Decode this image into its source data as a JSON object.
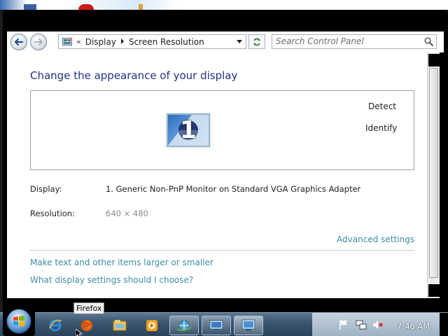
{
  "window": {
    "breadcrumb_separator_start": "«",
    "breadcrumb": [
      "Display",
      "Screen Resolution"
    ],
    "search_placeholder": "Search Control Panel"
  },
  "main": {
    "title": "Change the appearance of your display",
    "monitor_number": "1",
    "detect_label": "Detect",
    "identify_label": "Identify",
    "display_label": "Display:",
    "display_value": "1. Generic Non-PnP Monitor on Standard VGA Graphics Adapter",
    "resolution_label": "Resolution:",
    "resolution_value": "640 × 480",
    "advanced_settings": "Advanced settings",
    "links": [
      "Make text and other items larger or smaller",
      "What display settings should I choose?"
    ]
  },
  "taskbar": {
    "tooltip": "Firefox",
    "clock": "7:46 AM"
  },
  "colors": {
    "title": "#1e3287",
    "link": "#3d8ca7",
    "taskbar": "#3c5670"
  }
}
